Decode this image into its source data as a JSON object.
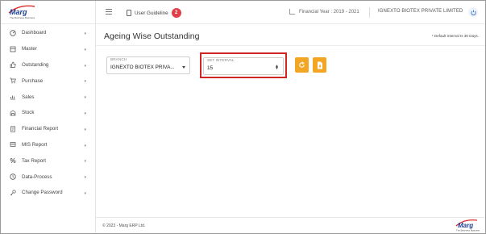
{
  "brand": {
    "logo_text": "Marg",
    "tagline": "The Business Business"
  },
  "sidebar": {
    "items": [
      {
        "label": "Dashboard",
        "icon": "dashboard-icon"
      },
      {
        "label": "Master",
        "icon": "master-icon"
      },
      {
        "label": "Outstanding",
        "icon": "thumbs-up-icon"
      },
      {
        "label": "Purchase",
        "icon": "cart-icon"
      },
      {
        "label": "Sales",
        "icon": "sales-icon"
      },
      {
        "label": "Stock",
        "icon": "stock-icon"
      },
      {
        "label": "Financial Report",
        "icon": "report-icon"
      },
      {
        "label": "MIS Report",
        "icon": "mis-icon"
      },
      {
        "label": "Tax Report",
        "icon": "percent-icon"
      },
      {
        "label": "Data-Process",
        "icon": "clock-icon"
      },
      {
        "label": "Change Password",
        "icon": "key-icon"
      }
    ]
  },
  "header": {
    "user_guideline": "User Guideline",
    "guideline_count": "2",
    "financial_year": "Financial Year : 2019 - 2021",
    "company": "IGNEXTO BIOTEX PRIVATE LIMITED"
  },
  "main": {
    "title": "Ageing Wise Outstanding",
    "note": "* Default Interval Is 30 Days.",
    "branch": {
      "label": "BRANCH",
      "value": "IGNEXTO BIOTEX PRIVA..."
    },
    "interval": {
      "label": "SET INTERVAL",
      "value": "15"
    }
  },
  "footer": {
    "copyright": "© 2023 - Marg ERP Ltd."
  },
  "colors": {
    "accent": "#f2a623",
    "badge": "#e0404a",
    "highlight": "#d32424",
    "logo": "#1c3f94"
  }
}
